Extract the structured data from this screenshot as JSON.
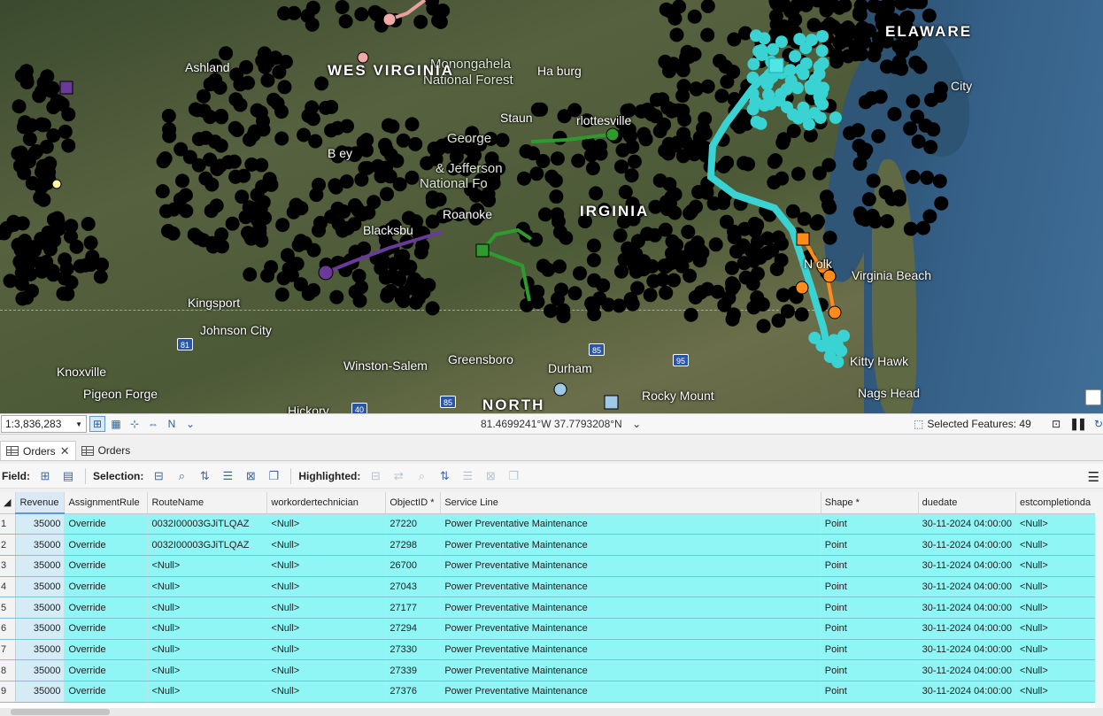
{
  "map": {
    "labels": {
      "delaware": "ELAWARE",
      "monongahela": "Monongahela",
      "national_forest": "National Forest",
      "ashland": "Ashland",
      "west_virginia": "WES VIRGINIA",
      "harrisonburg": "Ha         burg",
      "staunton": "Staun",
      "charlottesville": "rlottesville",
      "george": "George",
      "jefferson": "& Jefferson",
      "national_forest2": "National Fo",
      "roanoke": "Roanoke",
      "virginia": "IRGINIA",
      "blacksburg": "Blacksbu",
      "kingsport": "Kingsport",
      "johnson_city": "Johnson City",
      "knoxville": "Knoxville",
      "pigeon_forge": "Pigeon Forge",
      "winston_salem": "Winston-Salem",
      "greensboro": "Greensboro",
      "durham": "Durham",
      "north": "NORTH",
      "rocky_mount": "Rocky Mount",
      "norfolk": "N    olk",
      "virginia_beach": "Virginia Beach",
      "kitty_hawk": "Kitty Hawk",
      "nags_head": "Nags Head",
      "city": "City",
      "hickory": "Hickory",
      "covington": "B    ey"
    },
    "shields": [
      "81",
      "85",
      "95",
      "85",
      "40"
    ]
  },
  "statusbar": {
    "scale": "1:3,836,283",
    "coordinates": "81.4699241°W 37.7793208°N",
    "selected_features": "Selected Features: 49"
  },
  "tabs": [
    {
      "label": "Orders",
      "active": true,
      "closable": true
    },
    {
      "label": "Orders",
      "active": false,
      "closable": false
    }
  ],
  "toolbar": {
    "field_label": "Field:",
    "selection_label": "Selection:",
    "highlighted_label": "Highlighted:"
  },
  "table": {
    "columns": [
      "Revenue",
      "AssignmentRule",
      "RouteName",
      "workordertechnician",
      "ObjectID *",
      "Service Line",
      "Shape *",
      "duedate",
      "estcompletionda"
    ],
    "rows": [
      {
        "n": "1",
        "cells": [
          "35000",
          "Override",
          "0032I00003GJiTLQAZ",
          "<Null>",
          "27220",
          "Power Preventative Maintenance",
          "Point",
          "30-11-2024 04:00:00",
          "<Null>"
        ]
      },
      {
        "n": "2",
        "cells": [
          "35000",
          "Override",
          "0032I00003GJiTLQAZ",
          "<Null>",
          "27298",
          "Power Preventative Maintenance",
          "Point",
          "30-11-2024 04:00:00",
          "<Null>"
        ]
      },
      {
        "n": "3",
        "cells": [
          "35000",
          "Override",
          "<Null>",
          "<Null>",
          "26700",
          "Power Preventative Maintenance",
          "Point",
          "30-11-2024 04:00:00",
          "<Null>"
        ]
      },
      {
        "n": "4",
        "cells": [
          "35000",
          "Override",
          "<Null>",
          "<Null>",
          "27043",
          "Power Preventative Maintenance",
          "Point",
          "30-11-2024 04:00:00",
          "<Null>"
        ]
      },
      {
        "n": "5",
        "cells": [
          "35000",
          "Override",
          "<Null>",
          "<Null>",
          "27177",
          "Power Preventative Maintenance",
          "Point",
          "30-11-2024 04:00:00",
          "<Null>"
        ]
      },
      {
        "n": "6",
        "cells": [
          "35000",
          "Override",
          "<Null>",
          "<Null>",
          "27294",
          "Power Preventative Maintenance",
          "Point",
          "30-11-2024 04:00:00",
          "<Null>"
        ]
      },
      {
        "n": "7",
        "cells": [
          "35000",
          "Override",
          "<Null>",
          "<Null>",
          "27330",
          "Power Preventative Maintenance",
          "Point",
          "30-11-2024 04:00:00",
          "<Null>"
        ]
      },
      {
        "n": "8",
        "cells": [
          "35000",
          "Override",
          "<Null>",
          "<Null>",
          "27339",
          "Power Preventative Maintenance",
          "Point",
          "30-11-2024 04:00:00",
          "<Null>"
        ]
      },
      {
        "n": "9",
        "cells": [
          "35000",
          "Override",
          "<Null>",
          "<Null>",
          "27376",
          "Power Preventative Maintenance",
          "Point",
          "30-11-2024 04:00:00",
          "<Null>"
        ]
      }
    ]
  },
  "colors": {
    "selected_row": "#8ff5f5",
    "route_cyan": "#39d3d3",
    "orders_black": "#000000",
    "route_orange": "#ff8c1a",
    "route_green": "#2e9b2e",
    "route_purple": "#6a3a9a"
  }
}
